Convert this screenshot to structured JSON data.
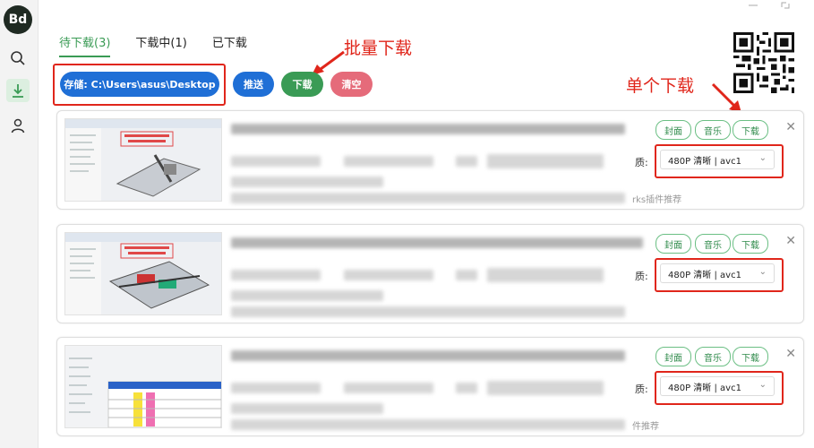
{
  "app": {
    "logo_text": "Bd"
  },
  "sidebar": {
    "items": [
      {
        "name": "search",
        "icon": "search-icon"
      },
      {
        "name": "download",
        "icon": "download-icon",
        "active": true
      },
      {
        "name": "user",
        "icon": "user-icon"
      }
    ]
  },
  "tabs": [
    {
      "label": "待下载(3)",
      "active": true
    },
    {
      "label": "下载中(1)"
    },
    {
      "label": "已下载"
    }
  ],
  "toolbar": {
    "storage_label": "存储: C:\\Users\\asus\\Desktop",
    "push_label": "推送",
    "download_label": "下载",
    "clear_label": "清空"
  },
  "annotations": {
    "batch_download": "批量下载",
    "single_download": "单个下载"
  },
  "items": [
    {
      "cover_label": "封面",
      "music_label": "音乐",
      "download_label": "下载",
      "quality_label": "质:",
      "quality_value": "480P 清晰 | avc1",
      "visible_suffix": "rks插件推荐"
    },
    {
      "cover_label": "封面",
      "music_label": "音乐",
      "download_label": "下载",
      "quality_label": "质:",
      "quality_value": "480P 清晰 | avc1",
      "visible_suffix": ""
    },
    {
      "cover_label": "封面",
      "music_label": "音乐",
      "download_label": "下载",
      "quality_label": "质:",
      "quality_value": "480P 清晰 | avc1",
      "visible_suffix": "件推荐"
    }
  ],
  "colors": {
    "green": "#3a9b55",
    "blue": "#1f6fd6",
    "pink": "#e56b7a",
    "red_annotation": "#e0261b"
  }
}
